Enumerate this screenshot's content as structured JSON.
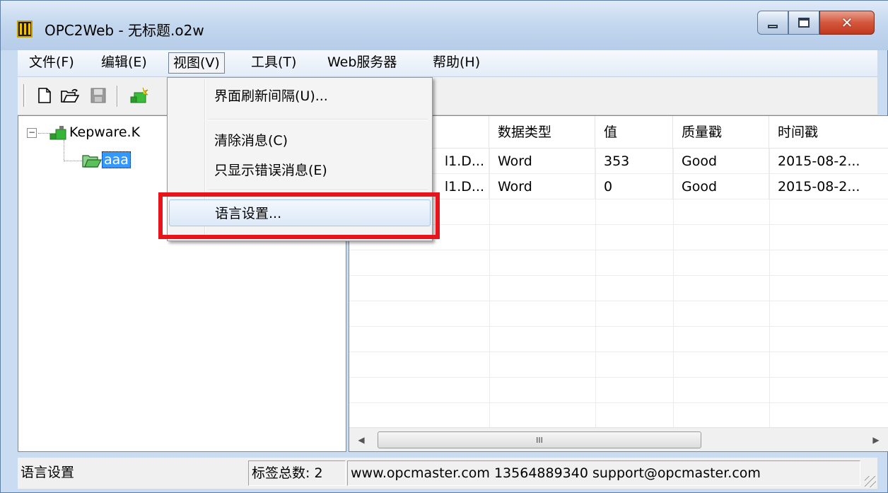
{
  "window": {
    "title": "OPC2Web - 无标题.o2w",
    "close_glyph": "✕"
  },
  "menu": {
    "items": [
      "文件(F)",
      "编辑(E)",
      "视图(V)",
      "工具(T)",
      "Web服务器",
      "帮助(H)"
    ],
    "open_index": 2
  },
  "view_menu": {
    "items": [
      "界面刷新间隔(U)...",
      "清除消息(C)",
      "只显示错误消息(E)",
      "语言设置..."
    ],
    "highlighted": "语言设置..."
  },
  "tree": {
    "expander": "−",
    "root_label": "Kepware.K",
    "child_label": "aaa"
  },
  "table": {
    "columns": [
      "",
      "数据类型",
      "值",
      "质量戳",
      "时间戳"
    ],
    "rows": [
      [
        "l1.D...",
        "Word",
        "353",
        "Good",
        "2015-08-2..."
      ],
      [
        "l1.D...",
        "Word",
        "0",
        "Good",
        "2015-08-2..."
      ]
    ]
  },
  "scrollbar": {
    "left_arrow": "◀",
    "right_arrow": "▶",
    "thumb_grip": "III"
  },
  "status": {
    "message": "语言设置",
    "tag_count": "标签总数: 2",
    "contact": "www.opcmaster.com 13564889340 support@opcmaster.com"
  },
  "colors": {
    "highlight_border": "#e8141b",
    "selection": "#3399ff",
    "title_gradient": "#c4d8ef"
  }
}
